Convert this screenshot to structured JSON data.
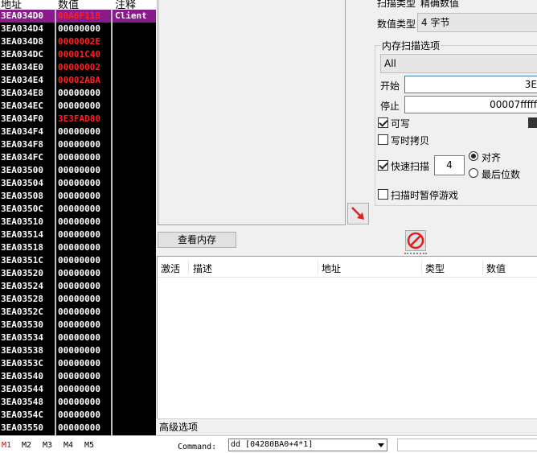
{
  "dump": {
    "headers": {
      "address": "地址",
      "value": "数值",
      "comment": "注释"
    },
    "rows": [
      {
        "addr": "3EA034D0",
        "val": "00A6F118",
        "cmt": "Client",
        "sel": true,
        "red": true
      },
      {
        "addr": "3EA034D4",
        "val": "00000000",
        "cmt": "",
        "red": false
      },
      {
        "addr": "3EA034D8",
        "val": "0000002E",
        "cmt": "",
        "red": true
      },
      {
        "addr": "3EA034DC",
        "val": "00001C40",
        "cmt": "",
        "red": true
      },
      {
        "addr": "3EA034E0",
        "val": "00000002",
        "cmt": "",
        "red": true
      },
      {
        "addr": "3EA034E4",
        "val": "00002ABA",
        "cmt": "",
        "red": true
      },
      {
        "addr": "3EA034E8",
        "val": "00000000",
        "cmt": "",
        "red": false
      },
      {
        "addr": "3EA034EC",
        "val": "00000000",
        "cmt": "",
        "red": false
      },
      {
        "addr": "3EA034F0",
        "val": "3E3FAD80",
        "cmt": "",
        "red": true
      },
      {
        "addr": "3EA034F4",
        "val": "00000000",
        "cmt": "",
        "red": false
      },
      {
        "addr": "3EA034F8",
        "val": "00000000",
        "cmt": "",
        "red": false
      },
      {
        "addr": "3EA034FC",
        "val": "00000000",
        "cmt": "",
        "red": false
      },
      {
        "addr": "3EA03500",
        "val": "00000000",
        "cmt": "",
        "red": false
      },
      {
        "addr": "3EA03504",
        "val": "00000000",
        "cmt": "",
        "red": false
      },
      {
        "addr": "3EA03508",
        "val": "00000000",
        "cmt": "",
        "red": false
      },
      {
        "addr": "3EA0350C",
        "val": "00000000",
        "cmt": "",
        "red": false
      },
      {
        "addr": "3EA03510",
        "val": "00000000",
        "cmt": "",
        "red": false
      },
      {
        "addr": "3EA03514",
        "val": "00000000",
        "cmt": "",
        "red": false
      },
      {
        "addr": "3EA03518",
        "val": "00000000",
        "cmt": "",
        "red": false
      },
      {
        "addr": "3EA0351C",
        "val": "00000000",
        "cmt": "",
        "red": false
      },
      {
        "addr": "3EA03520",
        "val": "00000000",
        "cmt": "",
        "red": false
      },
      {
        "addr": "3EA03524",
        "val": "00000000",
        "cmt": "",
        "red": false
      },
      {
        "addr": "3EA03528",
        "val": "00000000",
        "cmt": "",
        "red": false
      },
      {
        "addr": "3EA0352C",
        "val": "00000000",
        "cmt": "",
        "red": false
      },
      {
        "addr": "3EA03530",
        "val": "00000000",
        "cmt": "",
        "red": false
      },
      {
        "addr": "3EA03534",
        "val": "00000000",
        "cmt": "",
        "red": false
      },
      {
        "addr": "3EA03538",
        "val": "00000000",
        "cmt": "",
        "red": false
      },
      {
        "addr": "3EA0353C",
        "val": "00000000",
        "cmt": "",
        "red": false
      },
      {
        "addr": "3EA03540",
        "val": "00000000",
        "cmt": "",
        "red": false
      },
      {
        "addr": "3EA03544",
        "val": "00000000",
        "cmt": "",
        "red": false
      },
      {
        "addr": "3EA03548",
        "val": "00000000",
        "cmt": "",
        "red": false
      },
      {
        "addr": "3EA0354C",
        "val": "00000000",
        "cmt": "",
        "red": false
      },
      {
        "addr": "3EA03550",
        "val": "00000000",
        "cmt": "",
        "red": false
      }
    ]
  },
  "scan": {
    "scan_type_label": "扫描类型",
    "scan_type_value": "精确数值",
    "value_type_label": "数值类型",
    "value_type_value": "4 字节",
    "mem_options_title": "内存扫描选项",
    "region_value": "All",
    "start_label": "开始",
    "start_value": "3E",
    "stop_label": "停止",
    "stop_value": "00007fffff",
    "writable_label": "可写",
    "copy_on_write_label": "写时拷贝",
    "fast_scan_label": "快速扫描",
    "fast_scan_value": "4",
    "align_label": "对齐",
    "last_digits_label": "最后位数",
    "pause_game_label": "扫描时暂停游戏"
  },
  "buttons": {
    "view_memory": "查看内存"
  },
  "address_list": {
    "columns": [
      "激活",
      "描述",
      "地址",
      "类型",
      "数值"
    ],
    "advanced_options": "高级选项"
  },
  "status": {
    "tabs": [
      "M1",
      "M2",
      "M3",
      "M4",
      "M5"
    ],
    "command_label": "Command:",
    "command_value": "dd [04280BA0+4*1]"
  },
  "colors": {
    "selected_row": "#8a1a8a",
    "changed_value": "#ff2020",
    "active_tab": "#d00000"
  }
}
